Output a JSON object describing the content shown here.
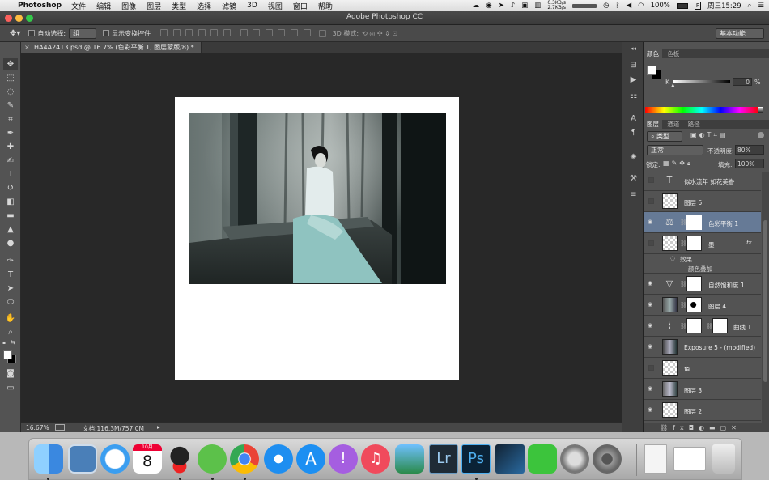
{
  "menubar": {
    "app_name": "Photoshop",
    "menus": [
      "文件",
      "编辑",
      "图像",
      "图层",
      "类型",
      "选择",
      "滤镜",
      "3D",
      "视图",
      "窗口",
      "帮助"
    ],
    "net_up": "0.3KB/s",
    "net_down": "2.7KB/s",
    "battery": "100%",
    "input_method": "P",
    "clock": "周三15:29"
  },
  "window": {
    "title": "Adobe Photoshop CC"
  },
  "options": {
    "auto_select_label": "自动选择:",
    "auto_select_value": "组",
    "show_transform_label": "显示变换控件",
    "mode_3d_label": "3D 模式:",
    "workspace": "基本功能"
  },
  "document": {
    "tab_title": "HA4A2413.psd @ 16.7% (色彩平衡 1, 图层蒙版/8) *"
  },
  "status": {
    "zoom": "16.67%",
    "doc_info": "文档:116.3M/757.0M"
  },
  "color_panel": {
    "tabs": [
      "颜色",
      "色板"
    ],
    "k_label": "K",
    "k_value": "0",
    "k_unit": "%"
  },
  "layers_panel": {
    "tabs": [
      "图层",
      "通道",
      "路径"
    ],
    "filter_kind": "类型",
    "blend_mode": "正常",
    "opacity_label": "不透明度:",
    "opacity_value": "80%",
    "lock_label": "锁定:",
    "fill_label": "填充:",
    "fill_value": "100%",
    "layers": [
      {
        "name": "似水流年  如花美眷",
        "visible": false,
        "type": "text"
      },
      {
        "name": "图层 6",
        "visible": false,
        "type": "pixel"
      },
      {
        "name": "色彩平衡 1",
        "visible": true,
        "type": "adjustment-balance",
        "selected": true
      },
      {
        "name": "墨",
        "visible": false,
        "type": "pixel-fx"
      },
      {
        "name": "效果",
        "type": "effect-header"
      },
      {
        "name": "颜色叠加",
        "type": "effect-item"
      },
      {
        "name": "自然饱和度 1",
        "visible": true,
        "type": "adjustment-vibrance"
      },
      {
        "name": "图层 4",
        "visible": true,
        "type": "masked-photo"
      },
      {
        "name": "曲线 1",
        "visible": true,
        "type": "adjustment-curves"
      },
      {
        "name": "Exposure 5 - (modified)",
        "visible": true,
        "type": "photo"
      },
      {
        "name": "鱼",
        "visible": false,
        "type": "pixel"
      },
      {
        "name": "图层 3",
        "visible": true,
        "type": "photo"
      },
      {
        "name": "图层 2",
        "visible": true,
        "type": "pixel"
      }
    ]
  },
  "dock": {
    "calendar_month": "10月",
    "calendar_day": "8",
    "apps": [
      "finder",
      "mail-bird",
      "messages",
      "calendar",
      "qq",
      "wechat",
      "chrome",
      "safari",
      "app-store",
      "podcasts",
      "itunes",
      "iphoto",
      "lightroom",
      "photoshop",
      "unknown-app",
      "facetime",
      "launchpad",
      "system-preferences",
      "document",
      "chrome-window",
      "trash"
    ],
    "lightroom_label": "Lr",
    "photoshop_label": "Ps"
  }
}
